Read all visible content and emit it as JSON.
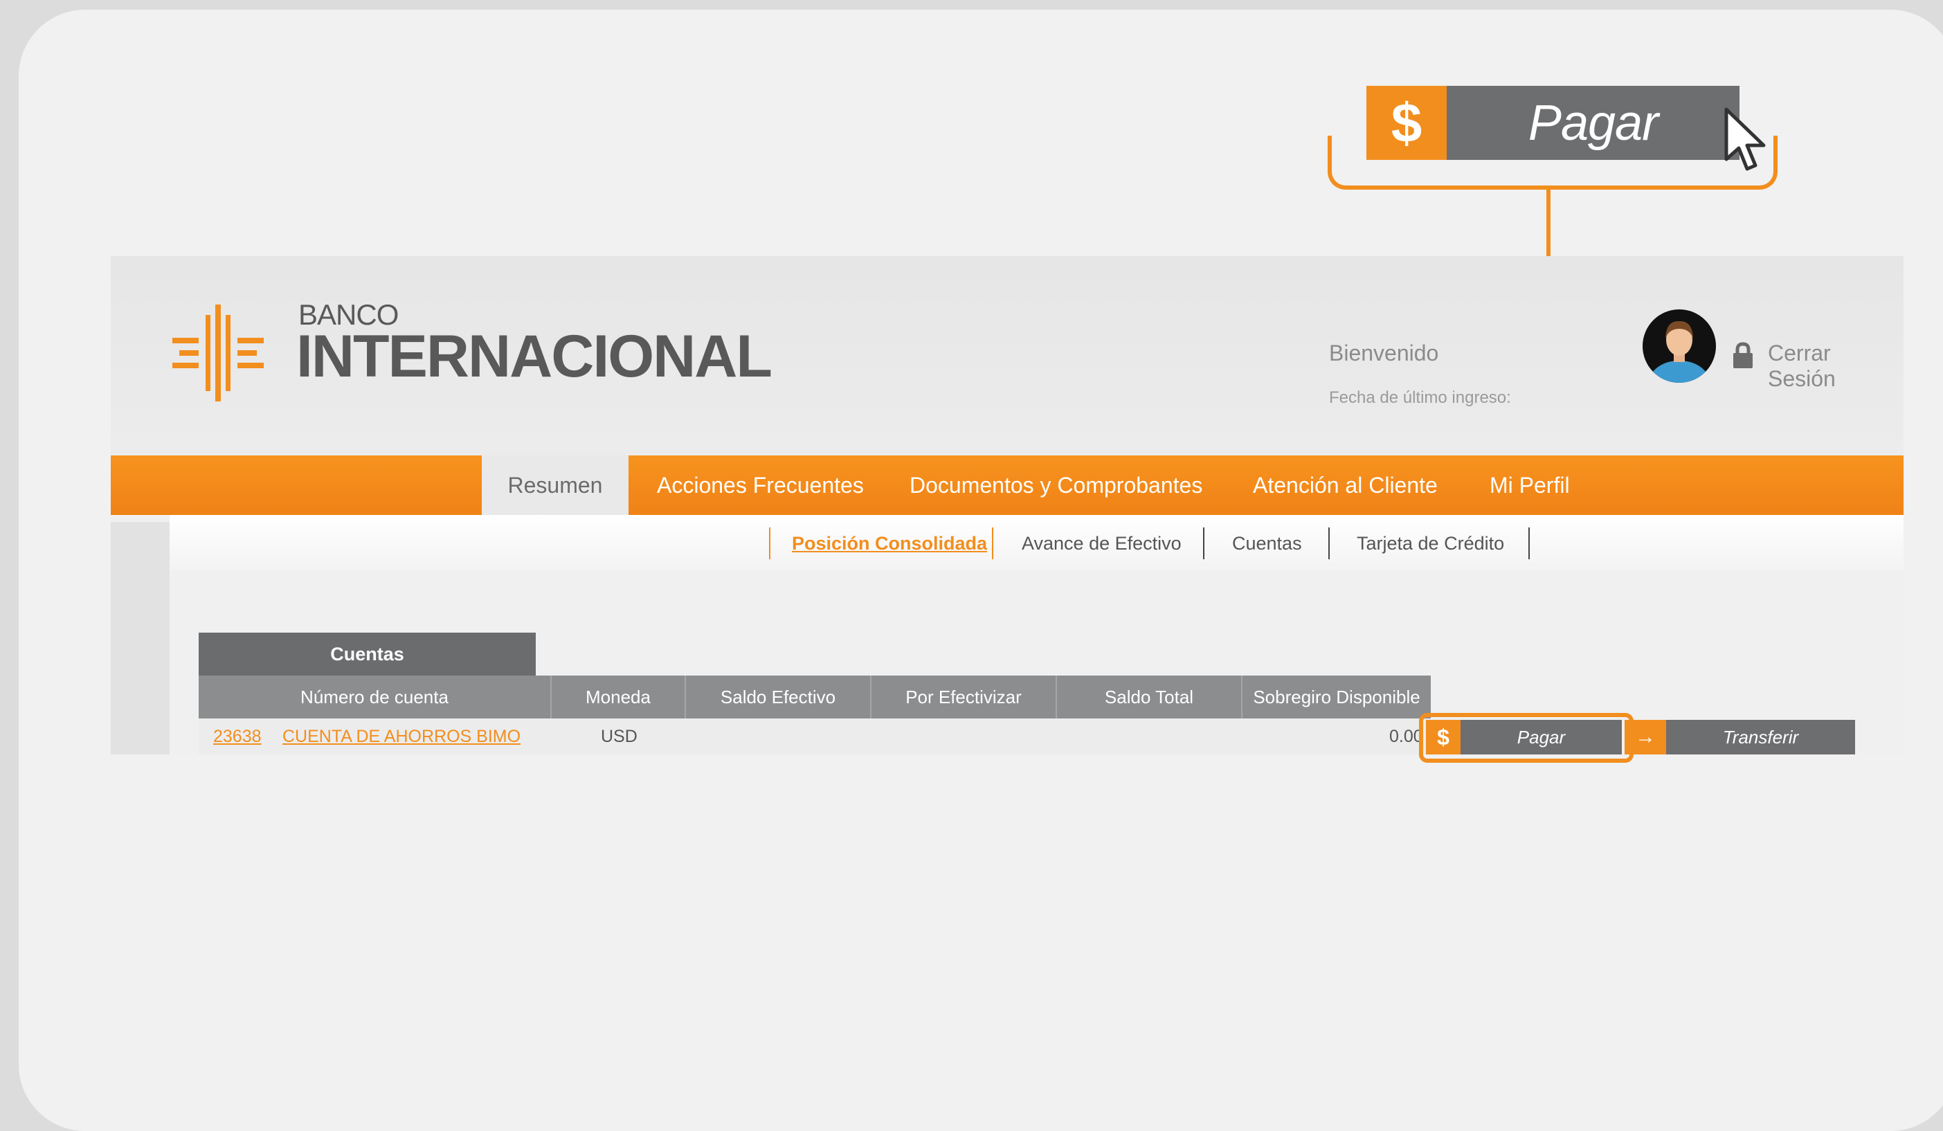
{
  "callout": {
    "icon": "dollar-icon",
    "symbol": "$",
    "label": "Pagar"
  },
  "brand": {
    "small": "BANCO",
    "big": "INTERNACIONAL"
  },
  "header": {
    "welcome": "Bienvenido",
    "last_login": "Fecha de último ingreso:",
    "logout": "Cerrar Sesión"
  },
  "nav": {
    "items": [
      "Resumen",
      "Acciones Frecuentes",
      "Documentos y Comprobantes",
      "Atención al Cliente",
      "Mi Perfil"
    ]
  },
  "subnav": {
    "items": [
      "Posición Consolidada",
      "Avance de Efectivo",
      "Cuentas",
      "Tarjeta de Crédito"
    ]
  },
  "table": {
    "tab": "Cuentas",
    "headers": [
      "Número de cuenta",
      "Moneda",
      "Saldo Efectivo",
      "Por Efectivizar",
      "Saldo Total",
      "Sobregiro Disponible"
    ],
    "row": {
      "number": "23638",
      "name": "CUENTA DE AHORROS BIMO",
      "currency": "USD",
      "overdraft": "0.00"
    }
  },
  "actions": {
    "pay_symbol": "$",
    "pay": "Pagar",
    "transfer_arrow": "→",
    "transfer": "Transferir"
  },
  "colors": {
    "accent": "#f28e1e",
    "button_gray": "#6d6e70",
    "header_gray": "#8c8d8f"
  }
}
